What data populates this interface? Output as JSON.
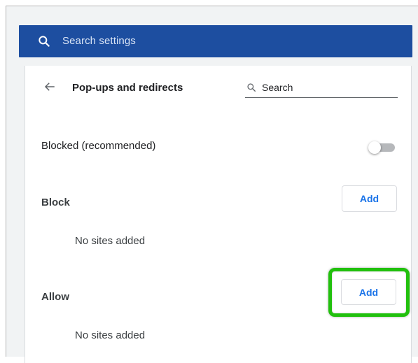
{
  "search_settings": {
    "placeholder": "Search settings",
    "icon": "search-icon"
  },
  "page": {
    "title": "Pop-ups and redirects",
    "back_icon": "arrow-left-icon",
    "search_label": "Search"
  },
  "blocked_setting": {
    "label": "Blocked (recommended)",
    "enabled": false
  },
  "block_section": {
    "label": "Block",
    "add_label": "Add",
    "empty_text": "No sites added"
  },
  "allow_section": {
    "label": "Allow",
    "add_label": "Add",
    "empty_text": "No sites added"
  },
  "colors": {
    "search_bar": "#1d4ea0",
    "accent": "#1a73e8",
    "highlight": "#21c00d"
  }
}
